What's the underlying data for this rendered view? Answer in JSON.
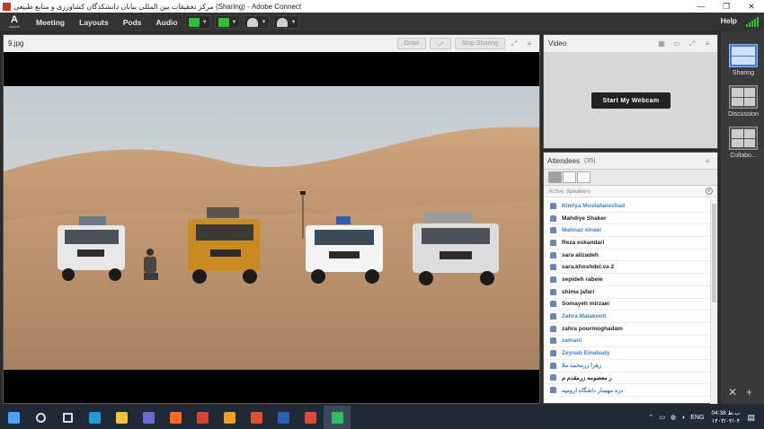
{
  "window": {
    "title": "مرکز تحقیقات بین المللی بیابان دانشکدگان کشاورزی و منابع طبیعی (Sharing) - Adobe Connect",
    "controls": [
      "—",
      "❐",
      "✕"
    ]
  },
  "menubar": {
    "logo_letter": "A",
    "logo_text": "Adobe",
    "items": [
      "Meeting",
      "Layouts",
      "Pods",
      "Audio"
    ],
    "help": "Help"
  },
  "share_pod": {
    "title": "9.jpg",
    "draw_label": "Draw",
    "stop_sharing_label": "Stop Sharing"
  },
  "video_pod": {
    "title": "Video",
    "webcam_button": "Start My Webcam"
  },
  "attendees_pod": {
    "title": "Attendees",
    "count": "(35)",
    "active_speakers_label": "Active Speakers",
    "list": [
      {
        "name": "Kimiya Mostafanezhad",
        "color": "#3f7fd0"
      },
      {
        "name": "Mahdiye Shaker",
        "color": "#222222"
      },
      {
        "name": "Mahnaz sinaei",
        "color": "#3f7fd0"
      },
      {
        "name": "Reza eskandari",
        "color": "#222222"
      },
      {
        "name": "sara alizadeh",
        "color": "#222222"
      },
      {
        "name": "sara.khoshdel.va 2",
        "color": "#222222"
      },
      {
        "name": "sepideh rabeie",
        "color": "#222222"
      },
      {
        "name": "shima jafari",
        "color": "#222222"
      },
      {
        "name": "Somayeh mirzaei",
        "color": "#222222"
      },
      {
        "name": "Zahra Malakooti",
        "color": "#3f7fd0"
      },
      {
        "name": "zahra pourmoghadam",
        "color": "#222222"
      },
      {
        "name": "zamani",
        "color": "#3f7fd0"
      },
      {
        "name": "Zeynab Einabady",
        "color": "#3f7fd0"
      },
      {
        "name": "زهرا زرمحمد ملا",
        "color": "#3f7fd0"
      },
      {
        "name": "ر معصومه زرمقدم م",
        "color": "#222222"
      },
      {
        "name": "دره مهسار داشگاه ارومیه",
        "color": "#3f7fd0"
      }
    ]
  },
  "layouts": [
    {
      "label": "Sharing",
      "active": true
    },
    {
      "label": "Discussion",
      "active": false
    },
    {
      "label": "Collabo...",
      "active": false
    }
  ],
  "taskbar": {
    "apps": [
      {
        "name": "windows-start",
        "color": "#4aa3ff"
      },
      {
        "name": "search",
        "color": "#dddddd"
      },
      {
        "name": "task-view",
        "color": "#dddddd"
      },
      {
        "name": "edge",
        "color": "#1f9bd6"
      },
      {
        "name": "file-explorer",
        "color": "#f3c13a"
      },
      {
        "name": "media-app",
        "color": "#6a6ad6"
      },
      {
        "name": "firefox",
        "color": "#ff6a1f"
      },
      {
        "name": "wps-presentation",
        "color": "#d8442c"
      },
      {
        "name": "app-orange",
        "color": "#f0a020"
      },
      {
        "name": "app-red",
        "color": "#e0502a"
      },
      {
        "name": "word",
        "color": "#2b5fb8"
      },
      {
        "name": "chrome",
        "color": "#dd4b39"
      },
      {
        "name": "adobe-connect",
        "color": "#2fbf5f"
      }
    ],
    "time": "04:38 ب.ظ",
    "date": "۱۴۰۳/۰۳/۰۴",
    "lang": "ENG"
  }
}
